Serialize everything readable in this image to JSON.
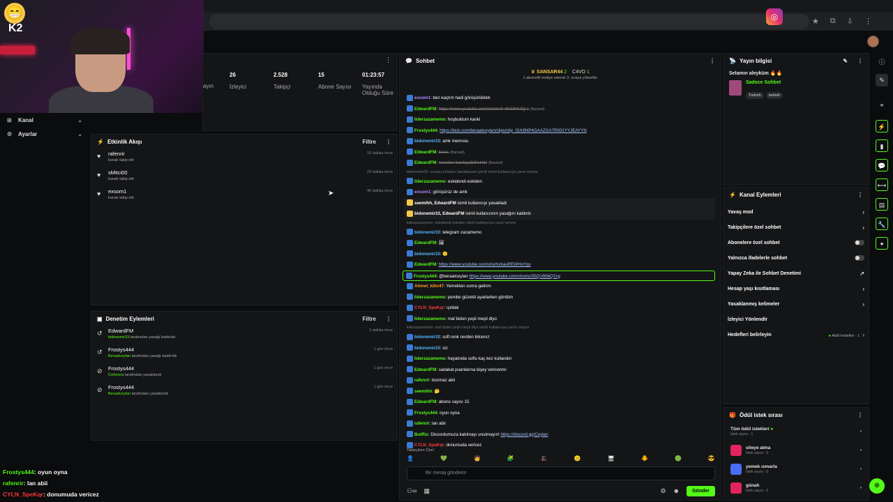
{
  "overlay_chat": [
    {
      "user": "Frostys444",
      "text": ": oyun oyna",
      "color": "#53fc18"
    },
    {
      "user": "rafenrir",
      "text": ": lan abii",
      "color": "#53fc18"
    },
    {
      "user": "CYLN_SpeKqr",
      "text": ": donumuda vericez",
      "color": "#ff3b3b"
    }
  ],
  "webcam": {
    "label": "K2"
  },
  "nav": {
    "channel": "Kanal",
    "settings": "Ayarlar"
  },
  "stats": [
    {
      "value": "",
      "label": "ayın"
    },
    {
      "value": "26",
      "label": "İzleyici"
    },
    {
      "value": "2.528",
      "label": "Takipçi"
    },
    {
      "value": "15",
      "label": "Abone Sayısı"
    },
    {
      "value": "01:23:57",
      "label": "Yayında Olduğu Süre"
    }
  ],
  "activity": {
    "title": "Etkinlik Akışı",
    "filter": "Filtre",
    "items": [
      {
        "name": "rafenrir",
        "desc": "kanalı takip etti",
        "time": "10 dakika önce"
      },
      {
        "name": "sMitci00",
        "desc": "kanalı takip etti",
        "time": "23 dakika önce"
      },
      {
        "name": "exsom1",
        "desc": "kanalı takip etti",
        "time": "46 dakika önce"
      }
    ]
  },
  "moderation": {
    "title": "Denetim Eylemleri",
    "filter": "Filtre",
    "items": [
      {
        "name": "EdwardFM",
        "actor": "bidonemir33",
        "desc": "tarafından yasağı kaldırıldı",
        "time": "2 dakika önce"
      },
      {
        "name": "Frostys444",
        "actor": "Beraatceylan",
        "desc": "tarafından yasağı kaldırıldı",
        "time": "1 gün önce"
      },
      {
        "name": "Frostys444",
        "actor": "Corticera",
        "desc": "tarafından yasaklandı",
        "time": "1 gün önce"
      },
      {
        "name": "Frostys444",
        "actor": "Beraatceylan",
        "desc": "tarafından yasaklandı",
        "time": "1 gün önce"
      }
    ]
  },
  "chat": {
    "title": "Sohbet",
    "top_user1": "SANSAR44",
    "top_count1": "2",
    "top_user2": "C4VO",
    "top_count2": "1",
    "top_note": "1 abonelik hediye ederek 3. sıraya yükseltin",
    "messages": [
      {
        "user": "exsom1",
        "ucolor": "#b28cff",
        "text": ": ben kaçtım hadi görüşürükkkk"
      },
      {
        "user": "EdwardFM",
        "ucolor": "#53fc18",
        "text": ": ",
        "link": "https://www.youtube.com/shorts/0-hK33HUIQ-s",
        "ban": true,
        "tag": "(Banned)"
      },
      {
        "user": "liderzazamemo",
        "ucolor": "#53fc18",
        "text": ": hoşbuldum kanki"
      },
      {
        "user": "Frostys444",
        "ucolor": "#53fc18",
        "text": ": ",
        "link": "https://kick.com/beraatceylan/clips/clip_01K8NP4GAAZGA7R931YYJEAYYN"
      },
      {
        "user": "bidonemir33",
        "ucolor": "#53b5fc",
        "text": ": amk memosu"
      },
      {
        "user": "EdwardFM",
        "ucolor": "#53fc18",
        "text": ": ",
        "strike": "benis",
        "tag": "(Banned)"
      },
      {
        "user": "EdwardFM",
        "ucolor": "#53fc18",
        "text": ": ",
        "strike": "nereden banlayabilirsiniki",
        "tag": "(Banned)"
      },
      {
        "sys": "bidonemir33: orospu evladını banlatacam şimdi isimli kullanıcıya yanıt veriyor"
      },
      {
        "user": "liderzazamemo",
        "ucolor": "#53fc18",
        "text": ": eskidendi eskiden"
      },
      {
        "user": "exsom1",
        "ucolor": "#b28cff",
        "text": ": görüşürüz de amk"
      },
      {
        "grey": true,
        "user": "seemihh, EdwardFM",
        "ucolor": "#fff",
        "text": " isimli kullanıcıyı yasakladı"
      },
      {
        "grey": true,
        "user": "bidonemir33, EdwardFM",
        "ucolor": "#fff",
        "text": " isimli kullanıcının yasağını kaldırdı"
      },
      {
        "sys": "liderzazamemo: eskidendi eskiden isimli kullanıcıya yanıt veriyor"
      },
      {
        "user": "bidonemir33",
        "ucolor": "#53b5fc",
        "text": ": telegram zazamemo"
      },
      {
        "user": "EdwardFM",
        "ucolor": "#53fc18",
        "text": ": 🖼"
      },
      {
        "user": "bidonemir33",
        "ucolor": "#53b5fc",
        "text": ": 🙂"
      },
      {
        "user": "EdwardFM",
        "ucolor": "#53fc18",
        "text": ": ",
        "link": "https://www.youtube.com/shorts/kauREWHoYgs"
      },
      {
        "hl": true,
        "user": "Frostys444",
        "ucolor": "#53fc18",
        "text": ": @beraatceylan ",
        "link": "https://www.youtube.com/shorts/35QU958Q7cg"
      },
      {
        "user": "Ahmet_kikn47",
        "ucolor": "#ff9f1c",
        "text": ": Yemekten sonra gelirim"
      },
      {
        "user": "liderzazamemo",
        "ucolor": "#53fc18",
        "text": ": pembe güzeldi ayarlarken gördüm"
      },
      {
        "user": "CYLN_SpeKqr",
        "ucolor": "#ff3b3b",
        "text": ": ışıldak"
      },
      {
        "user": "liderzazamemo",
        "ucolor": "#53fc18",
        "text": ": mal bidon yeşil meşil diyo"
      },
      {
        "sys": "liderzazamemo: mal bidon yeşil meşil diyo isimli kullanıcıya yanıt veriyor"
      },
      {
        "user": "bidonemir33",
        "ucolor": "#53b5fc",
        "text": ": soft renk nerden bilcenız"
      },
      {
        "user": "bidonemir33",
        "ucolor": "#53b5fc",
        "text": ": siz"
      },
      {
        "user": "liderzazamemo",
        "ucolor": "#53fc18",
        "text": ": hayatında softu kaç kez kullandın"
      },
      {
        "user": "EdwardFM",
        "ucolor": "#53fc18",
        "text": ": sadakat puanlarına bişey vericenmi"
      },
      {
        "user": "rafenrir",
        "ucolor": "#53fc18",
        "text": ": bozmaz abii"
      },
      {
        "user": "seemihh",
        "ucolor": "#53fc18",
        "text": ": 🤔"
      },
      {
        "user": "EdwardFM",
        "ucolor": "#53fc18",
        "text": ": abone sayısı 15"
      },
      {
        "user": "Frostys444",
        "ucolor": "#53fc18",
        "text": ": oyun oyna"
      },
      {
        "user": "rafenrir",
        "ucolor": "#53fc18",
        "text": ": lan abii"
      },
      {
        "user": "BotRix",
        "ucolor": "#53fc18",
        "text": ": Discordumuza katılmayı unutmayın! ",
        "link": "https://discord.gg/Ceylan"
      },
      {
        "user": "CYLN_SpeKqr",
        "ucolor": "#ff3b3b",
        "text": ": donumuda vericez"
      }
    ],
    "followers_only": "Takipçilere Özel",
    "input_placeholder": "Bir mesaj gönderin",
    "send": "Gönder"
  },
  "stream_info": {
    "title": "Yayın bilgisi",
    "greeting": "Selamın aleyküm 🔥🔥",
    "category": "Sadece Sohbet",
    "tags": [
      "Turkish",
      "turkish"
    ]
  },
  "channel_actions": {
    "title": "Kanal Eylemleri",
    "items": [
      {
        "label": "Yavaş mod",
        "kind": "chevron"
      },
      {
        "label": "Takipçilere özel sohbet",
        "kind": "chevron"
      },
      {
        "label": "Abonelere özel sohbet",
        "kind": "toggle"
      },
      {
        "label": "Yalnızca ifadelerle sohbet",
        "kind": "toggle"
      },
      {
        "label": "Yapay Zeka ile Sohbet Denetimi",
        "kind": "external"
      },
      {
        "label": "Hesap yaşı kısıtlaması",
        "kind": "chevron"
      },
      {
        "label": "Yasaklanmış kelimeler",
        "kind": "chevron"
      },
      {
        "label": "İzleyici Yönlendir",
        "kind": "none"
      },
      {
        "label": "Hedefleri belirleyin",
        "kind": "goal",
        "extra": "Aktif hedefler - 1"
      }
    ]
  },
  "rewards": {
    "title": "Ödül istek sırası",
    "items": [
      {
        "label": "Tüm ödül istekleri",
        "sub": "İstek sayısı - 1",
        "color": "#53fc18"
      },
      {
        "label": "siteye atma",
        "sub": "İstek sayısı - 0",
        "color": "#e0245e"
      },
      {
        "label": "yemek ısmarla",
        "sub": "İstek sayısı - 0",
        "color": "#4a6cf7"
      },
      {
        "label": "günah",
        "sub": "İstek sayısı - 0",
        "color": "#e0245e"
      }
    ]
  }
}
